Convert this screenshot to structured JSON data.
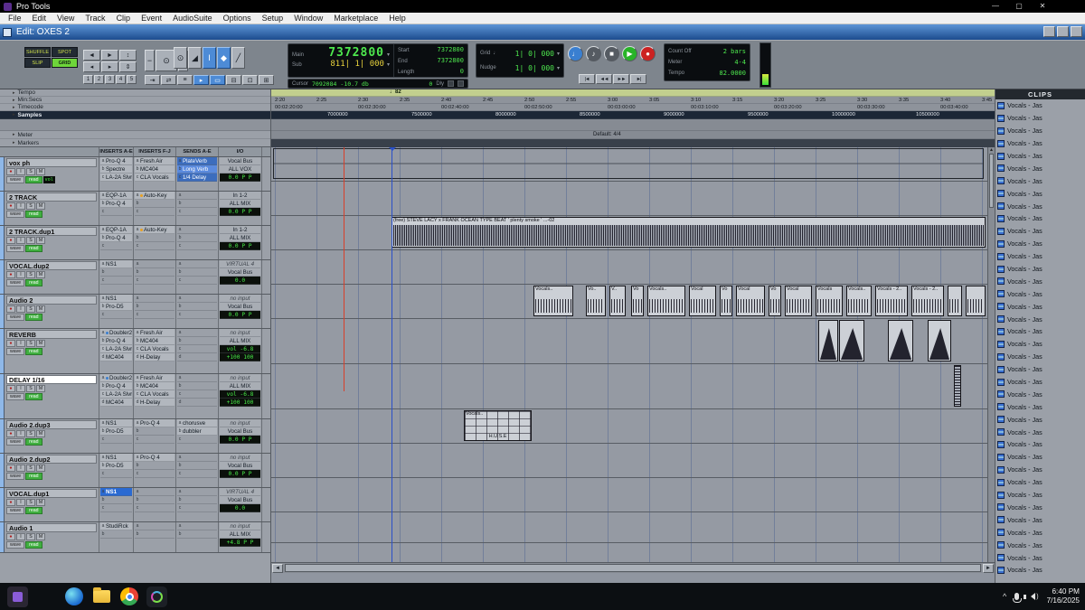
{
  "app": {
    "window_title": "Pro Tools",
    "window_controls": {
      "minimize": "—",
      "maximize": "▢",
      "close": "✕"
    }
  },
  "menubar": {
    "items": [
      "File",
      "Edit",
      "View",
      "Track",
      "Clip",
      "Event",
      "AudioSuite",
      "Options",
      "Setup",
      "Window",
      "Marketplace",
      "Help"
    ]
  },
  "edit_window": {
    "title": "Edit: OXES 2"
  },
  "icons": {
    "dropdown": "▾",
    "expand_arrow": "▸",
    "note": "♩",
    "grid_icon": "▦",
    "up": "▲",
    "down": "▼",
    "left": "◄",
    "right": "►",
    "chevron_up": "^",
    "speaker_arc": ")"
  },
  "toolbar": {
    "edit_modes": [
      {
        "label": "SHUFFLE",
        "active": false
      },
      {
        "label": "SPOT",
        "active": false
      },
      {
        "label": "SLIP",
        "active": false
      },
      {
        "label": "GRID",
        "active": true
      }
    ],
    "zoom_presets": [
      "1",
      "2",
      "3",
      "4",
      "5"
    ],
    "nav_buttons": [
      {
        "name": "scroll-prev-button",
        "glyph": "◄"
      },
      {
        "name": "scroll-next-button",
        "glyph": "►"
      },
      {
        "name": "extend-up-button",
        "glyph": "↕"
      },
      {
        "name": "audio-zoom-out-button",
        "glyph": "◂"
      },
      {
        "name": "audio-zoom-in-button",
        "glyph": "▸"
      },
      {
        "name": "waveform-zoom-button",
        "glyph": "⇕"
      }
    ],
    "zoom_group": [
      {
        "name": "zoom-out-button",
        "glyph": "−"
      },
      {
        "name": "magnifier-button",
        "glyph": "⊙"
      },
      {
        "name": "zoom-in-button",
        "glyph": "+"
      }
    ],
    "tools": [
      {
        "name": "zoom-tool",
        "glyph": "⊙",
        "active": false
      },
      {
        "name": "trim-tool",
        "glyph": "◢",
        "active": false
      },
      {
        "name": "selector-tool",
        "glyph": "Ι",
        "active": true
      },
      {
        "name": "grabber-tool",
        "glyph": "◆",
        "active": true
      },
      {
        "name": "pencil-tool",
        "glyph": "╱",
        "active": false
      }
    ],
    "toggles": [
      {
        "name": "tab-to-transient-button",
        "glyph": "⇥",
        "active": false
      },
      {
        "name": "mirrored-midi-button",
        "glyph": "⇄",
        "active": false
      },
      {
        "name": "link-timeline-edit-button",
        "glyph": "≡",
        "active": false
      },
      {
        "name": "insertion-follows-playback-button",
        "glyph": "▸",
        "active": true
      },
      {
        "name": "automation-follows-edit-button",
        "glyph": "▭",
        "active": true
      },
      {
        "name": "layered-editing-button",
        "glyph": "⊟",
        "active": false
      },
      {
        "name": "zoom-toggle-button",
        "glyph": "⊡",
        "active": false
      },
      {
        "name": "grid-display-button",
        "glyph": "⊞",
        "active": false
      }
    ],
    "counters": {
      "main_label": "Main",
      "main_value": "7372800",
      "sub_label": "Sub",
      "sub_value": "811| 1| 000",
      "start_label": "Start",
      "start_value": "7372800",
      "end_label": "End",
      "end_value": "7372800",
      "length_label": "Length",
      "length_value": "0",
      "cursor_label": "Cursor",
      "cursor_value": "7092084",
      "cursor_level": "-10.7 db",
      "dly_value": "0",
      "dly_label": "Dly"
    },
    "grid_nudge": {
      "grid_label": "Grid",
      "grid_value": "1| 0| 000",
      "nudge_label": "Nudge",
      "nudge_value": "1| 0| 000"
    },
    "transport": [
      {
        "name": "metronome-button",
        "glyph": "♩",
        "color": "#3a7fd0"
      },
      {
        "name": "midi-merge-button",
        "glyph": "♪",
        "color": "#555b62"
      },
      {
        "name": "stop-button",
        "glyph": "■",
        "color": "#555b62"
      },
      {
        "name": "play-button",
        "glyph": "▶",
        "color": "#28b428"
      },
      {
        "name": "record-button",
        "glyph": "●",
        "color": "#cc2222"
      }
    ],
    "skip_buttons": [
      {
        "name": "go-to-start-button",
        "glyph": "|◄"
      },
      {
        "name": "rewind-button",
        "glyph": "◄◄"
      },
      {
        "name": "fast-forward-button",
        "glyph": "►►"
      },
      {
        "name": "go-to-end-button",
        "glyph": "►|"
      }
    ],
    "session_box": {
      "count_off_label": "Count Off",
      "count_off_value": "2 bars",
      "meter_label": "Meter",
      "meter_value": "4-4",
      "tempo_label": "Tempo",
      "tempo_value": "82.0000"
    }
  },
  "track_area": {
    "column_headers": [
      "INSERTS A-E",
      "INSERTS F-J",
      "SENDS A-E",
      "I/O"
    ],
    "slot_letters": [
      "a",
      "b",
      "c",
      "d",
      "e"
    ],
    "track_buttons": [
      "●",
      "I",
      "S",
      "M"
    ],
    "wave_label": "wave",
    "read_label": "read",
    "tracks": [
      {
        "name": "vox ph",
        "extra": "vol",
        "inserts_ae": [
          "Pro-Q 4",
          "Spectre",
          "LA-2A Slvr"
        ],
        "inserts_fj": [
          "Fresh Air",
          "MC404",
          "CLA Vocals"
        ],
        "sends_ae": [
          "PlateVerb",
          "Long Verb",
          "1/4 Delay"
        ],
        "sends_blue": true,
        "io": [
          "Vocal Bus",
          "ALL VOX",
          "0.0  P P"
        ]
      },
      {
        "name": "2 TRACK",
        "inserts_ae": [
          "EQP-1A",
          "Pro-Q 4"
        ],
        "inserts_fj": [
          "Auto-Key"
        ],
        "sends_ae": [],
        "io": [
          "In 1-2",
          "ALL MIX",
          "0.0  P P"
        ]
      },
      {
        "name": "2 TRACK.dup1",
        "inserts_ae": [
          "EQP-1A",
          "Pro-Q 4"
        ],
        "inserts_fj": [
          "Auto-Key"
        ],
        "sends_ae": [],
        "io": [
          "In 1-2",
          "ALL MIX",
          "0.0  P P"
        ]
      },
      {
        "name": "VOCAL.dup2",
        "inserts_ae": [
          "NS1"
        ],
        "inserts_fj": [],
        "sends_ae": [],
        "io": [
          "VIRTUAL 4",
          "Vocal Bus",
          "0.0"
        ]
      },
      {
        "name": "Audio 2",
        "inserts_ae": [
          "NS1",
          "Pro-D5"
        ],
        "inserts_fj": [],
        "sends_ae": [],
        "io": [
          "no input",
          "Vocal Bus",
          "0.0  P P"
        ]
      },
      {
        "name": "REVERB",
        "inserts_ae": [
          "Doubler2",
          "Pro-Q 4",
          "LA-2A Slvr",
          "MC404"
        ],
        "inserts_fj": [
          "Fresh Air",
          "MC404",
          "CLA Vocals",
          "H-Delay"
        ],
        "sends_ae": [],
        "io": [
          "no input",
          "ALL MIX",
          "vol  -6.8",
          "+100  100"
        ]
      },
      {
        "name": "DELAY 1/16",
        "selected": true,
        "inserts_ae": [
          "Doubler2",
          "Pro-Q 4",
          "LA-2A Slvr",
          "MC404"
        ],
        "inserts_fj": [
          "Fresh Air",
          "MC404",
          "CLA Vocals",
          "H-Delay"
        ],
        "sends_ae": [],
        "io": [
          "no input",
          "ALL MIX",
          "vol  -6.8",
          "+100  100"
        ]
      },
      {
        "name": "Audio 2.dup3",
        "inserts_ae": [
          "NS1",
          "Pro-D5"
        ],
        "inserts_fj": [
          "Pro-Q 4"
        ],
        "sends_ae": [
          "chorusve",
          "dubbler"
        ],
        "io": [
          "no input",
          "Vocal Bus",
          "0.0  P P"
        ]
      },
      {
        "name": "Audio 2.dup2",
        "inserts_ae": [
          "NS1",
          "Pro-D5"
        ],
        "inserts_fj": [
          "Pro-Q 4"
        ],
        "sends_ae": [],
        "io": [
          "no input",
          "Vocal Bus",
          "0.0  P P"
        ]
      },
      {
        "name": "VOCAL.dup1",
        "inserts_ae": [
          "NS1"
        ],
        "active_insert": 0,
        "inserts_fj": [],
        "sends_ae": [],
        "io": [
          "VIRTUAL 4",
          "Vocal Bus",
          "0.0"
        ]
      },
      {
        "name": "Audio 1",
        "inserts_ae": [
          "StudiRck"
        ],
        "inserts_fj": [],
        "sends_ae": [],
        "io": [
          "no input",
          "ALL MIX",
          "+4.8  P P"
        ]
      }
    ]
  },
  "timeline": {
    "ruler_names": [
      "Tempo",
      "Min:Secs",
      "Timecode",
      "Samples",
      "Meter",
      "Markers"
    ],
    "min_secs": [
      "2:20",
      "2:25",
      "2:30",
      "2:35",
      "2:40",
      "2:45",
      "2:50",
      "2:55",
      "3:00",
      "3:05",
      "3:10",
      "3:15",
      "3:20",
      "3:25",
      "3:30",
      "3:35",
      "3:40",
      "3:45"
    ],
    "timecode": [
      "00:02:20:00",
      "00:02:30:00",
      "00:02:40:00",
      "00:02:50:00",
      "00:03:00:00",
      "00:03:10:00",
      "00:03:20:00",
      "00:03:30:00",
      "00:03:40:00"
    ],
    "samples": [
      "7000000",
      "7500000",
      "8000000",
      "8500000",
      "9000000",
      "9500000",
      "10000000",
      "10500000"
    ],
    "tempo_marker": "82",
    "meter_default": "Default: 4/4"
  },
  "arrangement": {
    "beat_clip_label": "(free) STEVE LACY x FRANK OCEAN TYPE BEAT ' plenty smoke ' ...-02",
    "vocal_clip_labels": [
      "Vocals..",
      "Vo..",
      "V..",
      "Vo",
      "Vocals..",
      "Vocal",
      "Vo",
      "Vocal",
      "Vo",
      "Vocal",
      "Vocals",
      "Vocals..",
      "Vocals - 2..",
      "Vocals - 2..",
      "",
      ""
    ],
    "small_clip_label": "Vocals..",
    "small_clip_caption": "H.U.S.E"
  },
  "clips_panel": {
    "header": "CLIPS",
    "item_label": "Vocals - Jas",
    "item_count": 38
  },
  "taskbar": {
    "icons": [
      {
        "name": "app-window-icon"
      },
      {
        "name": "start-button"
      },
      {
        "name": "edge-icon"
      },
      {
        "name": "file-explorer-icon"
      },
      {
        "name": "chrome-icon"
      },
      {
        "name": "pro-tools-icon"
      }
    ],
    "tray": {
      "time": "6:40 PM",
      "date": "7/16/2025"
    }
  }
}
